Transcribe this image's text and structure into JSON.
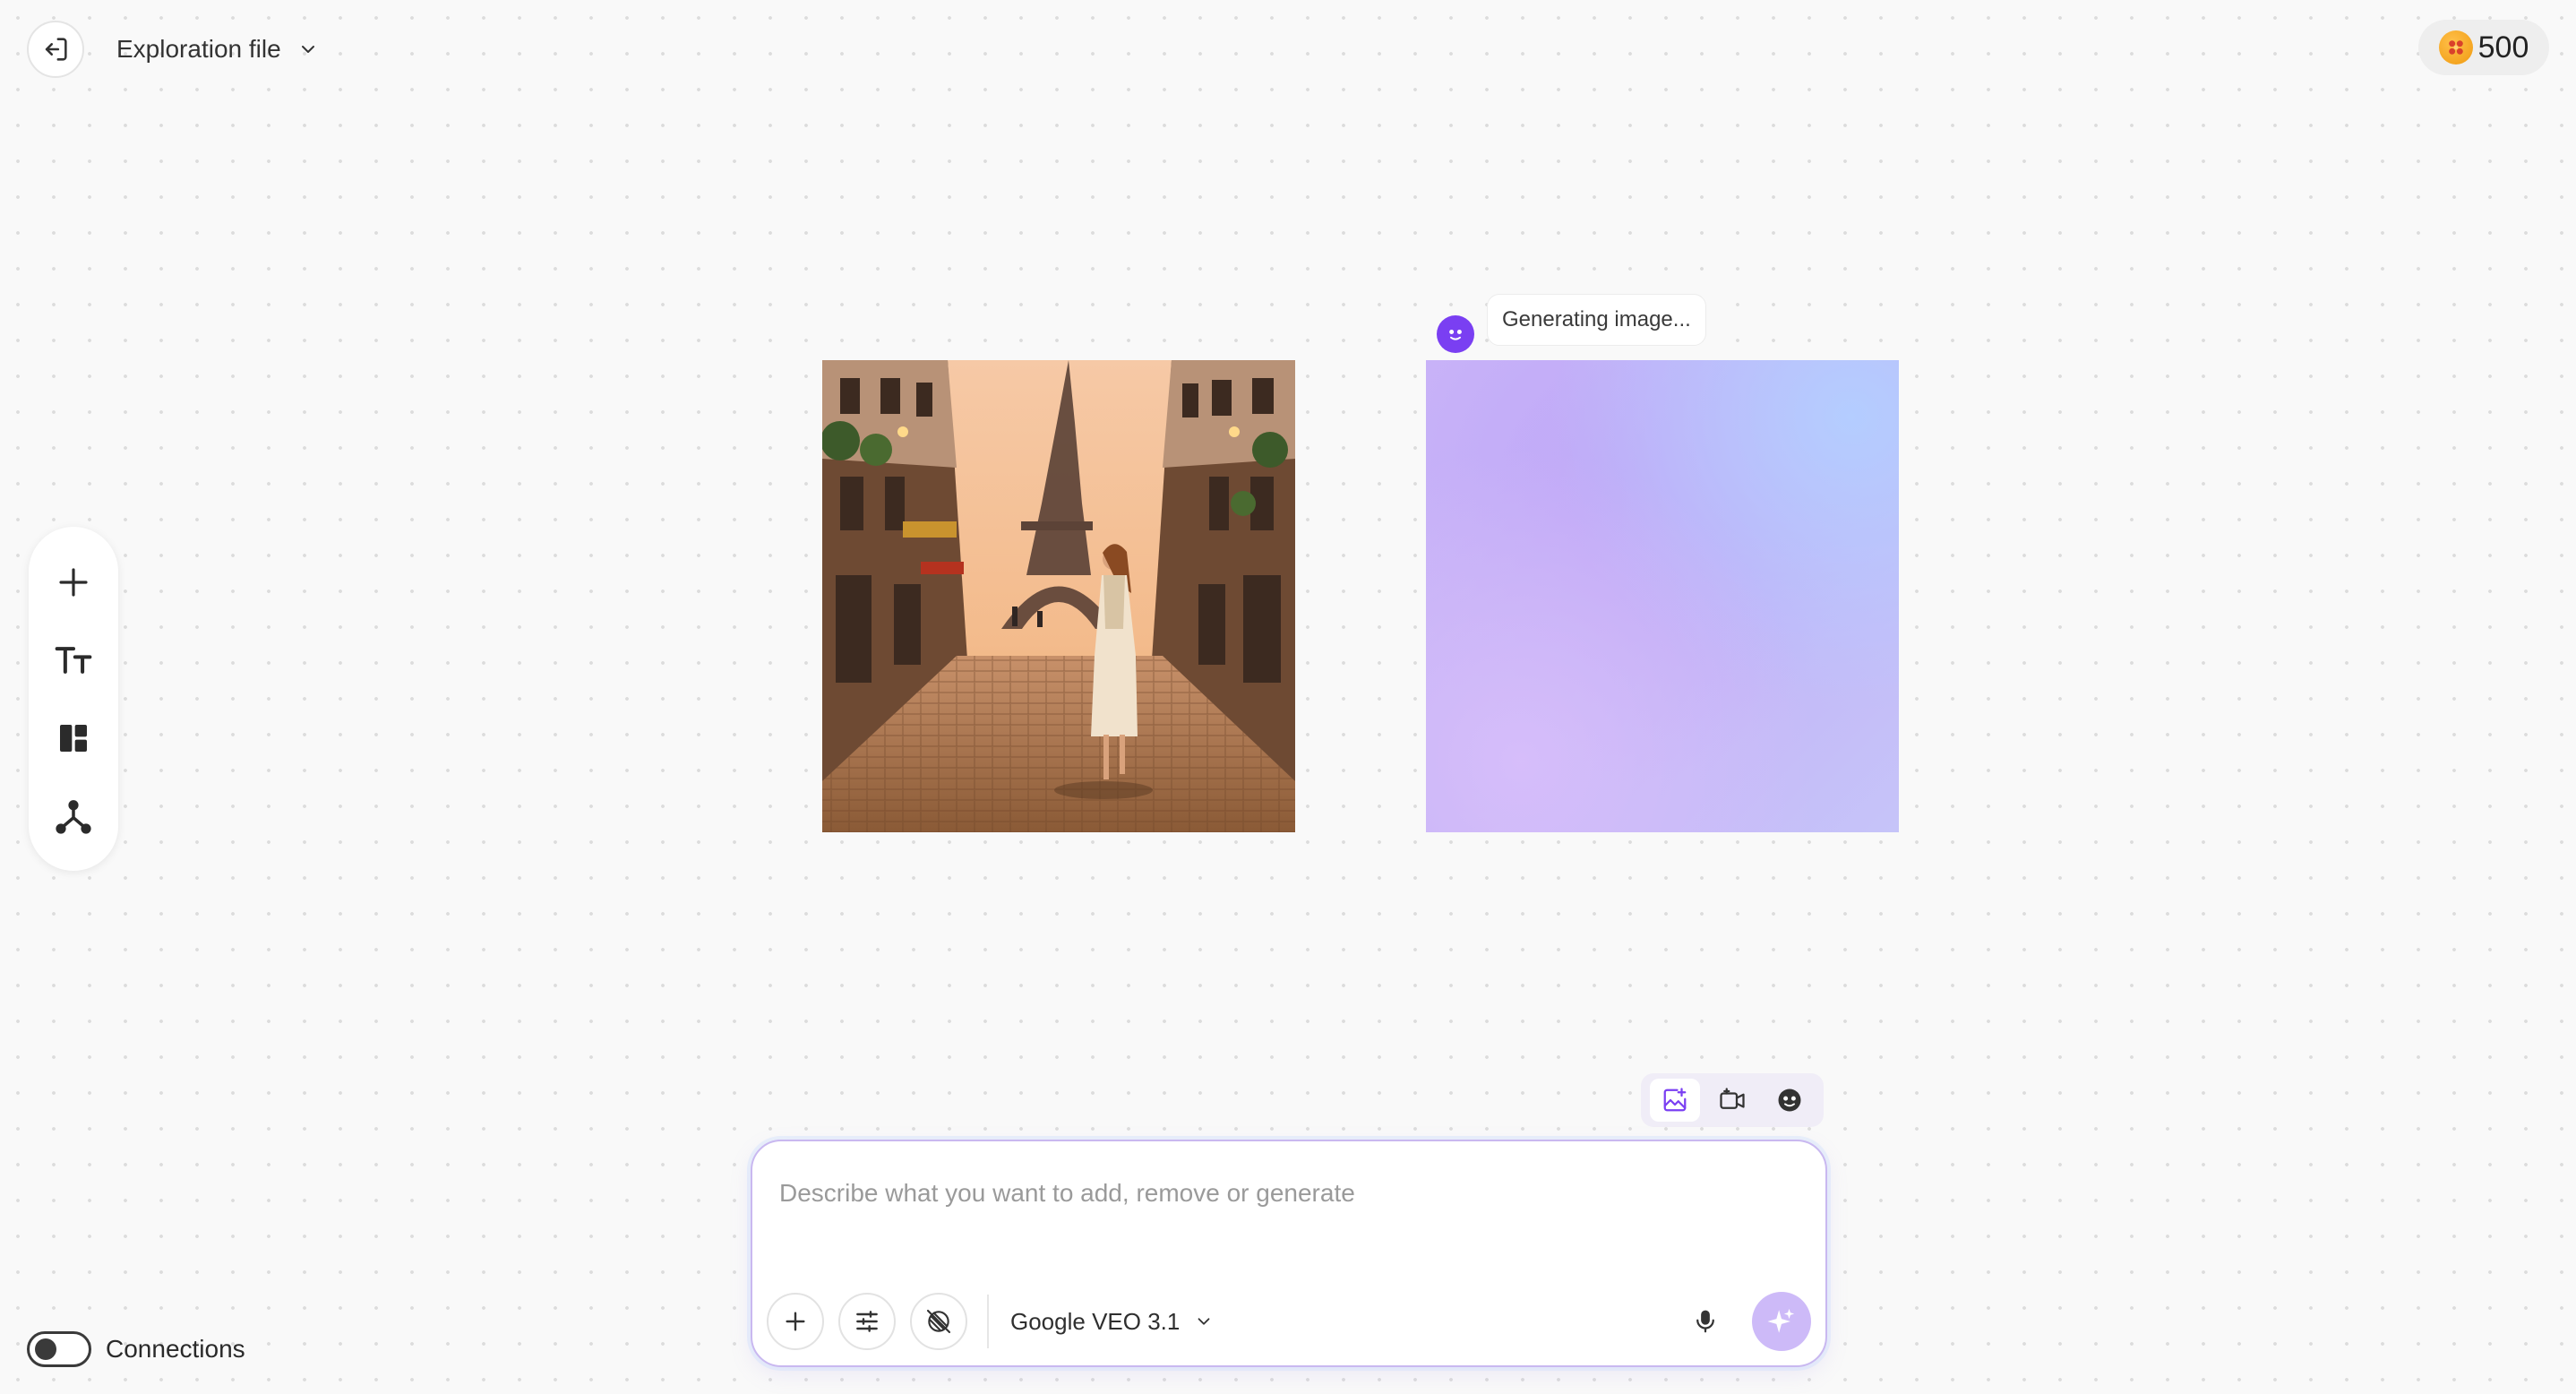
{
  "header": {
    "back_icon": "exit-arrow-icon",
    "file_name": "Exploration file",
    "credits": "500"
  },
  "toolbar": {
    "items": [
      {
        "name": "add",
        "icon": "plus-icon"
      },
      {
        "name": "text",
        "icon": "text-size-icon"
      },
      {
        "name": "layout",
        "icon": "dashboard-layout-icon"
      },
      {
        "name": "connect",
        "icon": "node-branch-icon"
      }
    ]
  },
  "canvas": {
    "source_image_icon": "photo-eiffel-street",
    "generating_label": "Generating image..."
  },
  "modes": {
    "items": [
      "image-generate-icon",
      "video-generate-icon",
      "avatar-face-icon"
    ],
    "active": "image-generate-icon"
  },
  "prompt": {
    "placeholder": "Describe what you want to add, remove or generate",
    "value": "",
    "model": "Google VEO 3.1"
  },
  "connections": {
    "label": "Connections",
    "enabled": false
  },
  "colors": {
    "accent": "#7a3ff2",
    "send_button": "#cdbaf8",
    "coin": "#f0a020"
  }
}
